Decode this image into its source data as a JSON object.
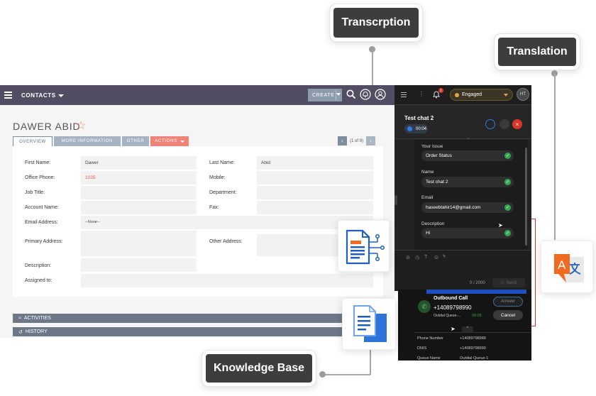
{
  "callouts": {
    "transcription": "Transcrption",
    "translation": "Translation",
    "knowledge_base": "Knowledge Base"
  },
  "crm": {
    "menu": "CONTACTS",
    "create_label": "CREATE",
    "contact_name": "DAWER ABID",
    "tabs": [
      "OVERVIEW",
      "MORE INFORMATION",
      "OTHER",
      "ACTIONS"
    ],
    "pager": "(1 of 9)",
    "fields": {
      "first_name_label": "First Name:",
      "first_name": "Dawer",
      "last_name_label": "Last Name:",
      "last_name": "Abid",
      "office_phone_label": "Office Phone:",
      "office_phone": "1035",
      "mobile_label": "Mobile:",
      "job_title_label": "Job Title:",
      "department_label": "Department:",
      "account_name_label": "Account Name:",
      "fax_label": "Fax:",
      "email_label": "Email Address:",
      "email_value": "--None--",
      "primary_address_label": "Primary Address:",
      "other_address_label": "Other Address:",
      "description_label": "Description:",
      "assigned_to_label": "Assigned to:"
    },
    "activities": "ACTIVITIES",
    "history": "HISTORY"
  },
  "chat": {
    "notification_count": "1",
    "status": "Engaged",
    "agent_initials": "HT",
    "chat_title": "Test chat 2",
    "timer": "00:04",
    "form": [
      {
        "label": "Your Issue",
        "value": "Order Status"
      },
      {
        "label": "Name",
        "value": "Test chat 2"
      },
      {
        "label": "Email",
        "value": "haseebtahir14@gmail.com"
      },
      {
        "label": "Description",
        "value": "Hi"
      }
    ],
    "counter": "0 / 2000",
    "send_label": "Send"
  },
  "phone": {
    "title": "Outbound Call",
    "number": "+14089798990",
    "queue": "Outdial Queue-...",
    "duration": "00:05",
    "answer_label": "Answer",
    "cancel_label": "Cancel",
    "details": [
      {
        "label": "Phone Number",
        "value": "+14089798989"
      },
      {
        "label": "DNIS",
        "value": "+14089798990"
      },
      {
        "label": "Queue Name",
        "value": "Outdial Queue-1"
      }
    ]
  },
  "colors": {
    "nav": "#534d64",
    "accent": "#f08377",
    "tab": "#a5b4c3",
    "success": "#2fa84f"
  }
}
